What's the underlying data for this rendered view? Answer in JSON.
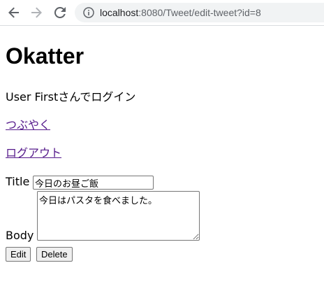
{
  "browser": {
    "url_host": "localhost",
    "url_path": ":8080/Tweet/edit-tweet?id=8",
    "icons": {
      "back": "back-arrow-icon",
      "forward": "forward-arrow-icon",
      "reload": "reload-icon",
      "info": "info-icon"
    }
  },
  "page": {
    "title": "Okatter",
    "login_text": "User Firstさんでログイン",
    "links": {
      "tweet": "つぶやく",
      "logout": "ログアウト"
    },
    "form": {
      "title_label": "Title",
      "title_value": "今日のお昼ご飯",
      "body_label": "Body",
      "body_value": "今日はパスタを食べました。",
      "edit_button": "Edit",
      "delete_button": "Delete"
    }
  }
}
